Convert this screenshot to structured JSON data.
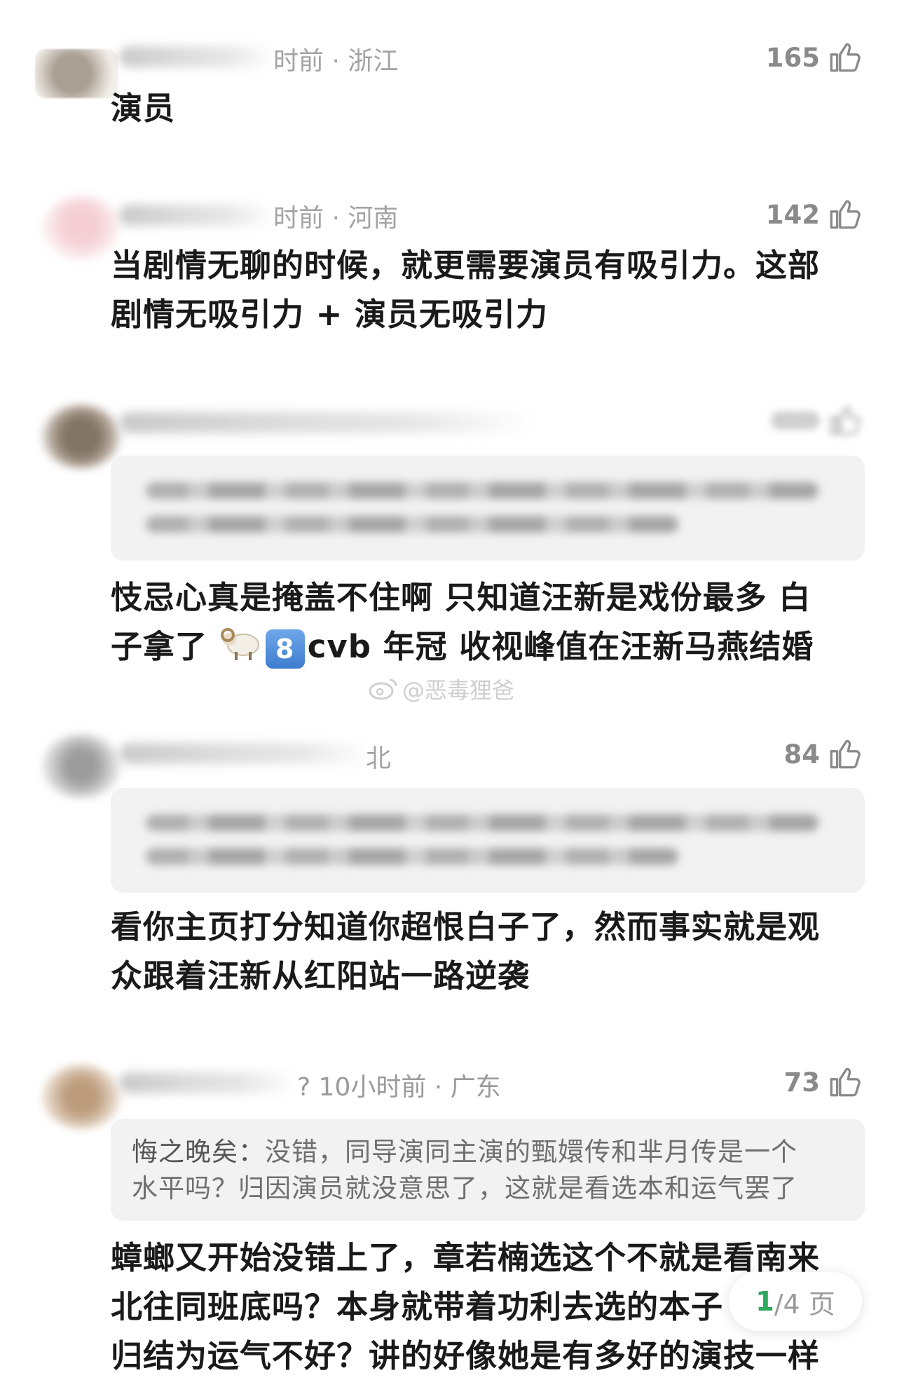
{
  "comments": [
    {
      "meta": "时前 · 浙江",
      "likes": "165",
      "text": "演员"
    },
    {
      "meta": "时前 · 河南",
      "likes": "142",
      "text_line1": "当剧情无聊的时候，就更需要演员有吸引力。这部",
      "text_line2": "剧情无吸引力 + 演员无吸引力"
    },
    {
      "text_line1": "忮忌心真是掩盖不住啊 只知道汪新是戏份最多 白",
      "text_line2_a": "子拿了",
      "text_line2_keycap": "8",
      "text_line2_b": "cvb 年冠  收视峰值在汪新马燕结婚"
    },
    {
      "meta": "北",
      "likes": "84",
      "text_line1": "看你主页打分知道你超恨白子了，然而事实就是观",
      "text_line2": "众跟着汪新从红阳站一路逆袭"
    },
    {
      "meta": "? 10小时前 · 广东",
      "likes": "73",
      "quote_name": "悔之晚矣：",
      "quote_line1": "没错，同导演同主演的甄嬛传和芈月传是一个",
      "quote_line2": "水平吗？归因演员就没意思了，这就是看选本和运气罢了",
      "text_line1": "蟑螂又开始没错上了，章若楠选这个不就是看南来",
      "text_line2": "北往同班底吗？本身就带着功利去选的本子",
      "text_line3": "归结为运气不好？讲的好像她是有多好的演技一样"
    }
  ],
  "watermark": "@恶毒狸爸",
  "pager": {
    "current": "1",
    "total_suffix": "/4 页"
  },
  "icons": {
    "like": "thumbs-up-icon",
    "sheep": "ram-emoji",
    "weibo": "weibo-logo-icon"
  }
}
